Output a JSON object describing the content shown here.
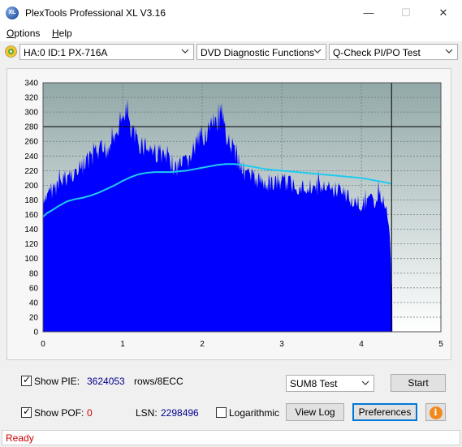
{
  "window": {
    "title": "PlexTools Professional XL V3.16",
    "icon_text": "XL",
    "minimize_symbol": "—",
    "maximize_symbol": "☐",
    "close_symbol": "✕"
  },
  "menu": {
    "items": [
      {
        "label": "Options",
        "accel": "O",
        "rest": "ptions"
      },
      {
        "label": "Help",
        "accel": "H",
        "rest": "elp"
      }
    ]
  },
  "toolbar": {
    "drive": "HA:0 ID:1  PX-716A",
    "function": "DVD Diagnostic Functions",
    "test": "Q-Check PI/PO Test"
  },
  "chart_data": {
    "type": "area",
    "x_ticks": [
      "0",
      "1",
      "2",
      "3",
      "4",
      "5"
    ],
    "y_ticks": [
      "0",
      "20",
      "40",
      "60",
      "80",
      "100",
      "120",
      "140",
      "160",
      "180",
      "200",
      "220",
      "240",
      "260",
      "280",
      "300",
      "320",
      "340"
    ],
    "xlim": [
      0,
      5
    ],
    "ylim": [
      0,
      340
    ],
    "series": [
      {
        "color": "#0000ff",
        "x": [
          0.0,
          0.05,
          0.1,
          0.2,
          0.3,
          0.4,
          0.5,
          0.6,
          0.7,
          0.8,
          0.9,
          1.0,
          1.03,
          1.05,
          1.1,
          1.2,
          1.3,
          1.4,
          1.5,
          1.6,
          1.7,
          1.8,
          1.9,
          2.0,
          2.1,
          2.2,
          2.25,
          2.3,
          2.4,
          2.5,
          2.6,
          2.7,
          2.8,
          2.9,
          3.0,
          3.1,
          3.2,
          3.3,
          3.4,
          3.5,
          3.6,
          3.7,
          3.8,
          3.9,
          4.0,
          4.1,
          4.2,
          4.25,
          4.3,
          4.35,
          4.38,
          4.39
        ],
        "y": [
          180,
          195,
          205,
          215,
          225,
          232,
          240,
          250,
          258,
          265,
          285,
          300,
          320,
          330,
          290,
          275,
          270,
          262,
          255,
          245,
          238,
          245,
          265,
          285,
          295,
          305,
          310,
          290,
          265,
          238,
          225,
          220,
          218,
          215,
          218,
          215,
          212,
          210,
          212,
          208,
          205,
          207,
          200,
          190,
          185,
          188,
          190,
          195,
          190,
          150,
          80,
          50
        ]
      },
      {
        "color": "#1ecbf0",
        "x": [
          0.0,
          0.05,
          0.1,
          0.2,
          0.3,
          0.4,
          0.5,
          0.6,
          0.7,
          0.8,
          0.9,
          1.0,
          1.1,
          1.2,
          1.3,
          1.4,
          1.5,
          1.6,
          1.7,
          1.8,
          1.9,
          2.0,
          2.1,
          2.2,
          2.3,
          2.4,
          2.5,
          2.6,
          2.7,
          2.8,
          2.9,
          3.0,
          3.1,
          3.2,
          3.3,
          3.4,
          3.5,
          3.6,
          3.7,
          3.8,
          3.9,
          4.0,
          4.1,
          4.2,
          4.3,
          4.38
        ],
        "y": [
          157,
          162,
          165,
          172,
          178,
          181,
          183,
          186,
          190,
          195,
          200,
          206,
          211,
          215,
          217,
          218,
          218,
          218,
          219,
          220,
          222,
          224,
          226,
          228,
          229,
          229,
          228,
          226,
          224,
          222,
          221,
          220,
          219,
          218,
          217,
          216,
          215,
          214,
          213,
          212,
          211,
          210,
          208,
          206,
          204,
          202
        ]
      }
    ],
    "threshold": {
      "y": 280,
      "color": "#000000"
    },
    "end_marker": {
      "x": 4.38,
      "color": "#000000"
    }
  },
  "controls": {
    "show_pie_label": "Show PIE:",
    "pie_value": "3624053",
    "pie_unit": "rows/8ECC",
    "show_pof_label": "Show POF:",
    "pof_value": "0",
    "lsn_label": "LSN:",
    "lsn_value": "2298496",
    "log_label": "Logarithmic",
    "sum_select": "SUM8 Test",
    "start_label": "Start",
    "viewlog_label": "View Log",
    "prefs_label": "Preferences",
    "info_symbol": "i",
    "pie_color": "#00008b",
    "pof_color": "#d00000"
  },
  "status": {
    "text": "Ready"
  }
}
